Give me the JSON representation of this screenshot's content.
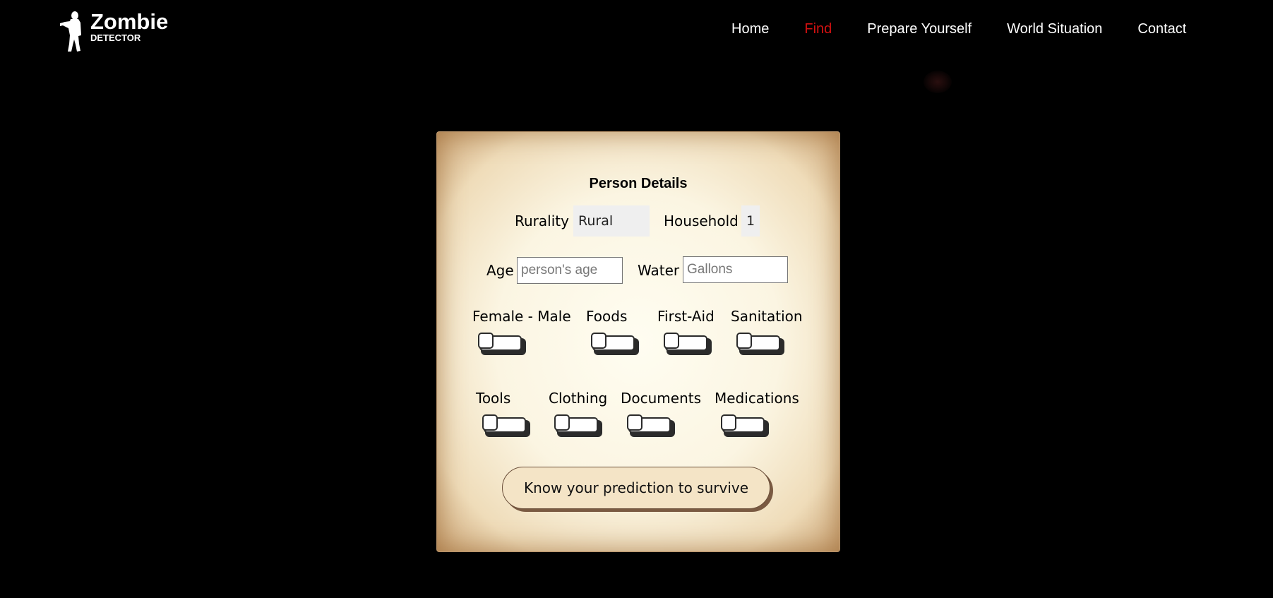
{
  "brand": {
    "title": "Zombie",
    "subtitle": "DETECTOR"
  },
  "nav": {
    "items": [
      "Home",
      "Find",
      "Prepare Yourself",
      "World Situation",
      "Contact"
    ],
    "active": "Find"
  },
  "colors": {
    "background": "#000000",
    "nav_active": "#d31111",
    "card_center": "#fffdf1",
    "card_edge": "#c9a273",
    "button_face": "#f4e4c6"
  },
  "form": {
    "title": "Person Details",
    "rurality": {
      "label": "Rurality",
      "value": "Rural"
    },
    "household": {
      "label": "Household",
      "value": "1"
    },
    "age": {
      "label": "Age",
      "placeholder": "person's age",
      "value": ""
    },
    "water": {
      "label": "Water",
      "placeholder": "Gallons",
      "value": ""
    },
    "toggles_row1": [
      {
        "label": "Female - Male",
        "on": false
      },
      {
        "label": "Foods",
        "on": false
      },
      {
        "label": "First-Aid",
        "on": false
      },
      {
        "label": "Sanitation",
        "on": false
      }
    ],
    "toggles_row2": [
      {
        "label": "Tools",
        "on": false
      },
      {
        "label": "Clothing",
        "on": false
      },
      {
        "label": "Documents",
        "on": false
      },
      {
        "label": "Medications",
        "on": false
      }
    ],
    "submit_label": "Know your prediction to survive"
  }
}
